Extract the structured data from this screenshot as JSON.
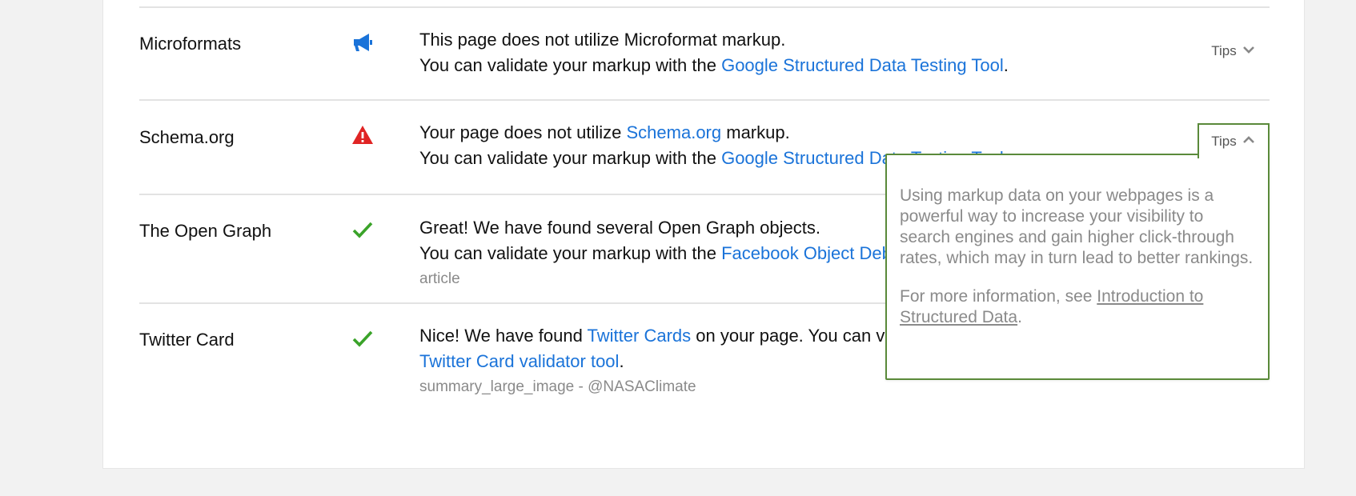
{
  "rows": [
    {
      "name": "Microformats",
      "icon": "megaphone-icon",
      "line1": "This page does not utilize Microformat markup.",
      "line2_pre": "You can validate your markup with the ",
      "line2_link": "Google Structured Data Testing Tool",
      "line2_post": ".",
      "tips_label": "Tips"
    },
    {
      "name": "Schema.org",
      "icon": "warning-icon",
      "line1_pre": "Your page does not utilize ",
      "line1_link": "Schema.org",
      "line1_post": " markup.",
      "line2_pre": "You can validate your markup with the ",
      "line2_link": "Google Structured Data Testing Tool",
      "line2_post": ".",
      "tips_label": "Tips"
    },
    {
      "name": "The Open Graph",
      "icon": "check-icon",
      "line1": "Great! We have found several Open Graph objects.",
      "line2_pre": "You can validate your markup with the ",
      "line2_link": "Facebook Object Debugger",
      "line2_post": ".",
      "sub": "article"
    },
    {
      "name": "Twitter Card",
      "icon": "check-icon",
      "line1_pre": "Nice! We have found ",
      "line1_link": "Twitter Cards",
      "line1_post": " on your page. You can validate your markup with the",
      "line2_link": "Twitter Card validator tool",
      "line2_post": ".",
      "sub": "summary_large_image - @NASAClimate"
    }
  ],
  "popover": {
    "para1": "Using markup data on your webpages is a powerful way to increase your visibility to search engines and gain higher click-through rates, which may in turn lead to better rankings.",
    "para2_pre": "For more information, see ",
    "para2_link": "Introduction to Structured Data",
    "para2_post": "."
  },
  "colors": {
    "link": "#1a73d9",
    "check": "#3aa329",
    "warning": "#e02424",
    "megaphone": "#1a73d9",
    "popover_border": "#5a8a3a"
  }
}
